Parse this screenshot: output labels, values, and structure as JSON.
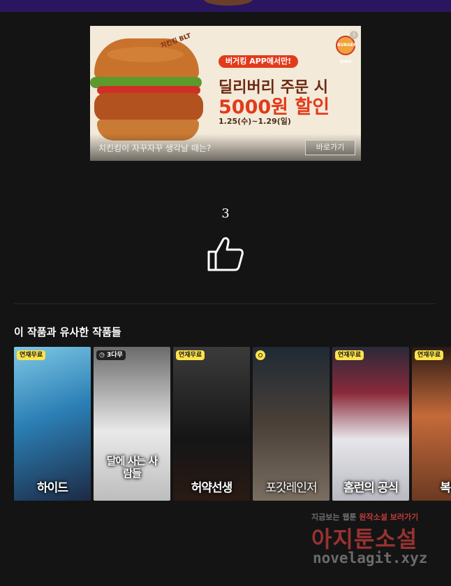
{
  "ad": {
    "stamp": "치킨킹 BLT",
    "pill": "버거킹 APP에서만!",
    "headline": "딜리버리 주문 시",
    "discount": "5000원 할인",
    "period": "1.25(수)~1.29(일)",
    "caption": "치킨킹이 자꾸자꾸 생각날 때는?",
    "cta": "바로가기",
    "logo": "BURGER KING",
    "info_icon": "i"
  },
  "like": {
    "count": "3"
  },
  "similar": {
    "title": "이 작품과 유사한 작품들",
    "items": [
      {
        "title": "하이드",
        "badge": "연재무료",
        "badge_style": "yellow",
        "colors": [
          "#2b7fb5",
          "#8fd0e8",
          "#1d2a44"
        ]
      },
      {
        "title": "달에 사는 사람들",
        "badge": "3다무",
        "badge_style": "clock",
        "colors": [
          "#e9e9e9",
          "#6b6b6b",
          "#1a1a1a"
        ]
      },
      {
        "title": "허약선생",
        "badge": "연재무료",
        "badge_style": "yellow",
        "colors": [
          "#3b3b3b",
          "#151515",
          "#5a3b2a"
        ]
      },
      {
        "title": "포갓레인저",
        "badge": "",
        "badge_style": "clock-only",
        "colors": [
          "#1f2a35",
          "#7a6e61",
          "#2a2a2a"
        ]
      },
      {
        "title": "홈런의 공식",
        "badge": "연재무료",
        "badge_style": "yellow",
        "colors": [
          "#e6e6ea",
          "#8a2a3a",
          "#2a2a3a"
        ]
      },
      {
        "title": "복마",
        "badge": "연재무료",
        "badge_style": "yellow",
        "colors": [
          "#6b3a22",
          "#c56a3a",
          "#2a1a14"
        ]
      }
    ]
  },
  "watermark": {
    "line1_a": "지금보는",
    "line1_b": "웹툰",
    "line1_c": "원작소설",
    "line1_d": "보러가기",
    "brand": "아지툰소설",
    "domain": "novelagit.xyz"
  }
}
